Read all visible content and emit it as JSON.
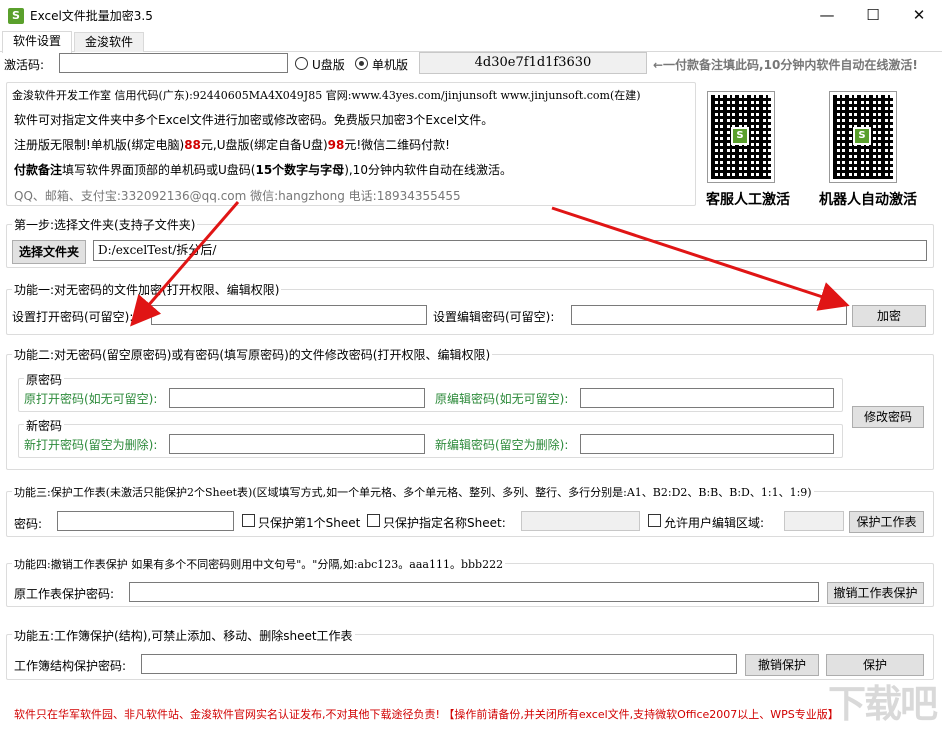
{
  "window": {
    "title": "Excel文件批量加密3.5",
    "icon_glyph": "S",
    "minimize_glyph": "—",
    "maximize_glyph": "☐",
    "close_glyph": "✕"
  },
  "tabs": [
    {
      "label": "软件设置",
      "active": true
    },
    {
      "label": "金浚软件",
      "active": false
    }
  ],
  "activation": {
    "label": "激活码:",
    "code_value": "",
    "options": [
      "U盘版",
      "单机版"
    ],
    "selected": "单机版",
    "machine_code": "4d30e7f1d1f3630",
    "note": "←一付款备注填此码,10分钟内软件自动在线激活!"
  },
  "info": {
    "line1": "金浚软件开发工作室 信用代码(广东):92440605MA4X049J85 官网:www.43yes.com/jinjunsoft  www.jinjunsoft.com(在建)",
    "line2": "软件可对指定文件夹中多个Excel文件进行加密或修改密码。免费版只加密3个Excel文件。",
    "line3_a": "注册版无限制!单机版(绑定电脑)",
    "line3_p1": "88",
    "line3_b": "元,U盘版(绑定自备U盘)",
    "line3_p2": "98",
    "line3_c": "元!微信二维码付款!",
    "line4_a": "付款备注",
    "line4_b": "填写软件界面顶部的单机码或U盘码(",
    "line4_c": "15个数字与字母",
    "line4_d": "),10分钟内软件自动在线激活。",
    "line5": "QQ、邮箱、支付宝:332092136@qq.com   微信:hangzhong   电话:18934355455",
    "qr1_caption": "客服人工激活",
    "qr2_caption": "机器人自动激活"
  },
  "step1": {
    "legend": "第一步:选择文件夹(支持子文件夹)",
    "button": "选择文件夹",
    "path": "D:/excelTest/拆分后/"
  },
  "func1": {
    "legend": "功能一:对无密码的文件加密(打开权限、编辑权限)",
    "open_label": "设置打开密码(可留空):",
    "edit_label": "设置编辑密码(可留空):",
    "button": "加密"
  },
  "func2": {
    "legend": "功能二:对无密码(留空原密码)或有密码(填写原密码)的文件修改密码(打开权限、编辑权限)",
    "old_legend": "原密码",
    "old_open": "原打开密码(如无可留空):",
    "old_edit": "原编辑密码(如无可留空):",
    "new_legend": "新密码",
    "new_open": "新打开密码(留空为删除):",
    "new_edit": "新编辑密码(留空为删除):",
    "button": "修改密码"
  },
  "func3": {
    "legend": "功能三:保护工作表(未激活只能保护2个Sheet表)(区域填写方式,如一个单元格、多个单元格、整列、多列、整行、多行分别是:A1、B2:D2、B:B、B:D、1:1、1:9)",
    "pwd_label": "密码:",
    "cb1": "只保护第1个Sheet",
    "cb2": "只保护指定名称Sheet:",
    "cb3": "允许用户编辑区域:",
    "button": "保护工作表"
  },
  "func4": {
    "legend": "功能四:撤销工作表保护  如果有多个不同密码则用中文句号\"。\"分隔,如:abc123。aaa111。bbb222",
    "label": "原工作表保护密码:",
    "button": "撤销工作表保护"
  },
  "func5": {
    "legend": "功能五:工作簿保护(结构),可禁止添加、移动、删除sheet工作表",
    "label": "工作簿结构保护密码:",
    "btn_cancel": "撤销保护",
    "btn_protect": "保护"
  },
  "footer": {
    "text_a": "软件只在华军软件园、非凡软件站、金浚软件官网实名认证发布,不对其他下载途径负责!",
    "text_b": "【操作前请备份,并关闭所有excel文件,支持微软Office2007以上、WPS专业版】"
  },
  "watermark": "下载吧",
  "colors": {
    "accent_green": "#2c8a3a",
    "price_red": "#d10000",
    "arrow_red": "#e01515"
  }
}
